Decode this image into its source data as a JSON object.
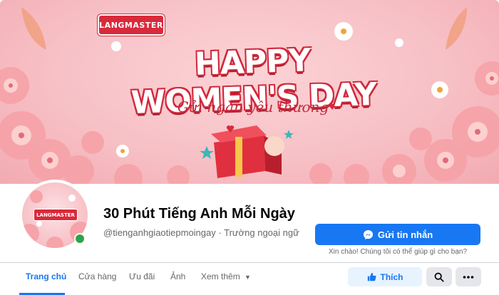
{
  "cover": {
    "logo_text": "LANGMASTER",
    "headline": "HAPPY WOMEN'S DAY",
    "tagline": "Gửi ngàn yêu thương"
  },
  "profile": {
    "badge_text": "LANGMASTER",
    "online": true
  },
  "page": {
    "name": "30 Phút Tiếng Anh Mỗi Ngày",
    "handle": "@tienganhgiaotiepmoingay",
    "separator": "·",
    "category": "Trường ngoại ngữ"
  },
  "actions": {
    "message_label": "Gửi tin nhắn",
    "message_icon": "messenger-icon",
    "helper_text": "Xin chào! Chúng tôi có thể giúp gì cho bạn?",
    "like_label": "Thích",
    "like_icon": "thumbs-up-icon",
    "search_icon": "search-icon",
    "more_icon": "more-icon"
  },
  "tabs": [
    {
      "label": "Trang chủ",
      "active": true
    },
    {
      "label": "Cửa hàng"
    },
    {
      "label": "Ưu đãi"
    },
    {
      "label": "Ảnh"
    },
    {
      "label": "Xem thêm"
    }
  ],
  "colors": {
    "accent": "#1877f2",
    "brand_red": "#d92a3b",
    "cover_pink": "#f7c1c6"
  }
}
